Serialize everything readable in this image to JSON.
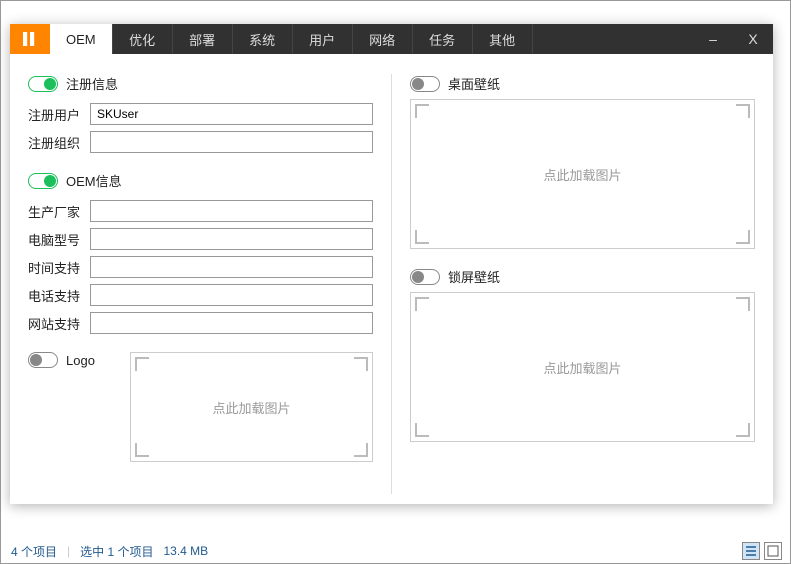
{
  "explorer": {
    "status_items": "4 个项目",
    "status_selected": "选中 1 个项目",
    "status_size": "13.4 MB"
  },
  "tabs": {
    "t0": "OEM",
    "t1": "优化",
    "t2": "部署",
    "t3": "系统",
    "t4": "用户",
    "t5": "网络",
    "t6": "任务",
    "t7": "其他"
  },
  "win": {
    "min": "–",
    "close": "X"
  },
  "sections": {
    "reg": "注册信息",
    "oem": "OEM信息",
    "logo": "Logo",
    "desktop": "桌面壁纸",
    "lock": "锁屏壁纸"
  },
  "labels": {
    "reg_user": "注册用户",
    "reg_org": "注册组织",
    "mfr": "生产厂家",
    "model": "电脑型号",
    "time": "时间支持",
    "phone": "电话支持",
    "web": "网站支持"
  },
  "values": {
    "reg_user": "SKUser",
    "reg_org": "",
    "mfr": "",
    "model": "",
    "time": "",
    "phone": "",
    "web": ""
  },
  "img_hint": "点此加载图片"
}
